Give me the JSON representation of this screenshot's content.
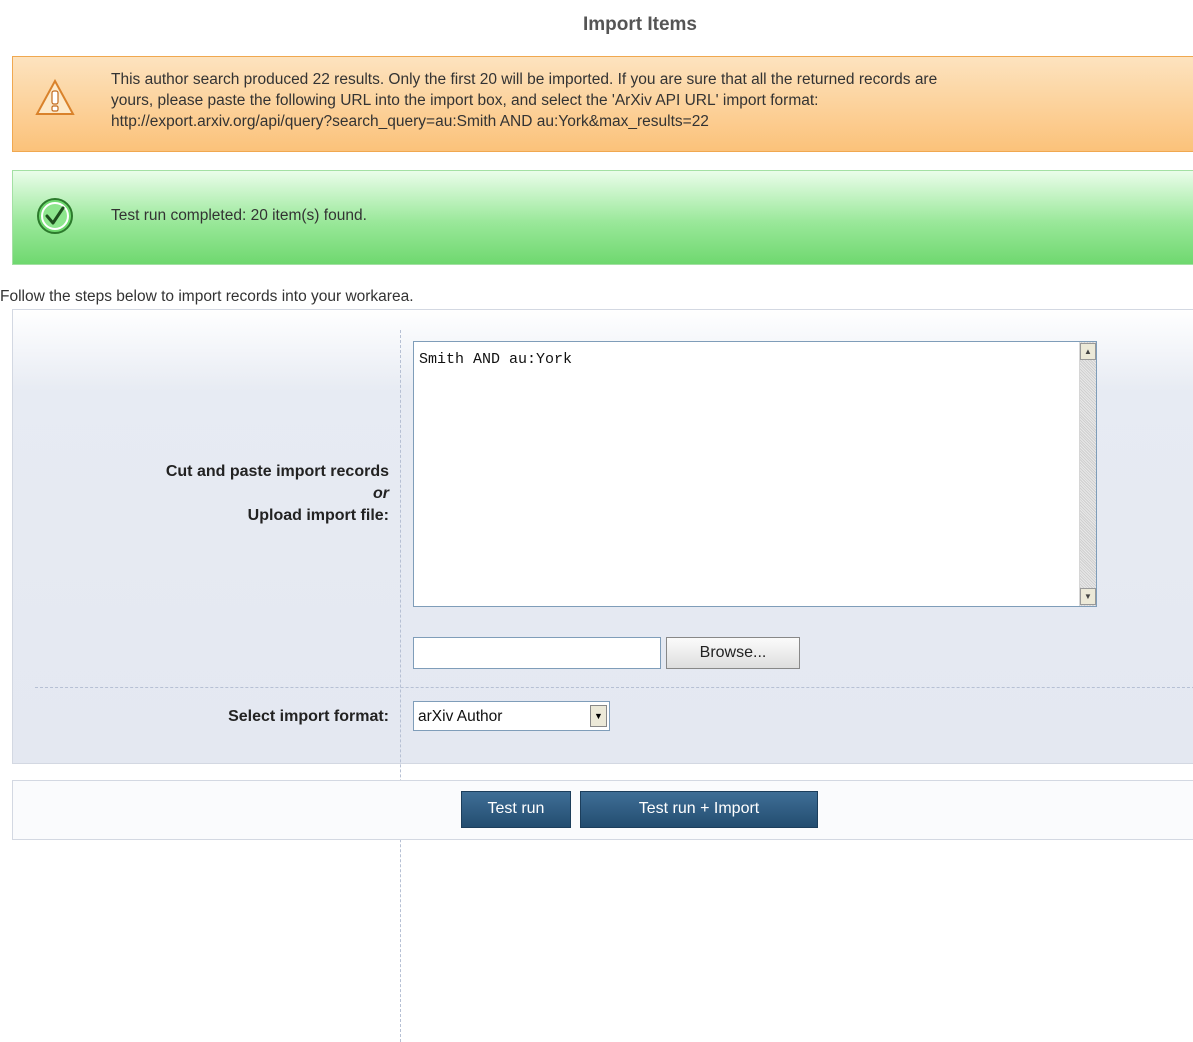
{
  "page": {
    "title": "Import Items"
  },
  "warning": {
    "icon": "warning-triangle-icon",
    "line1": "This author search produced 22 results. Only the first 20 will be imported. If you are sure that all the returned records are",
    "line2": "yours, please paste the following URL into the import box, and select the 'ArXiv API URL' import format:",
    "line3": "http://export.arxiv.org/api/query?search_query=au:Smith AND au:York&max_results=22"
  },
  "success": {
    "icon": "check-circle-icon",
    "message": "Test run completed: 20 item(s) found."
  },
  "intro": "Follow the steps below to import records into your workarea.",
  "form": {
    "paste_label": "Cut and paste import records",
    "or_label": "or",
    "upload_label": "Upload import file:",
    "textarea_value": "Smith AND au:York",
    "file_value": "",
    "browse_label": "Browse...",
    "format_label": "Select import format:",
    "format_value": "arXiv Author"
  },
  "actions": {
    "test_run_label": "Test run",
    "test_import_label": "Test run + Import"
  },
  "colors": {
    "warning_bg": "#fbc27a",
    "success_bg": "#6fd86f",
    "button_bg": "#234d70"
  }
}
